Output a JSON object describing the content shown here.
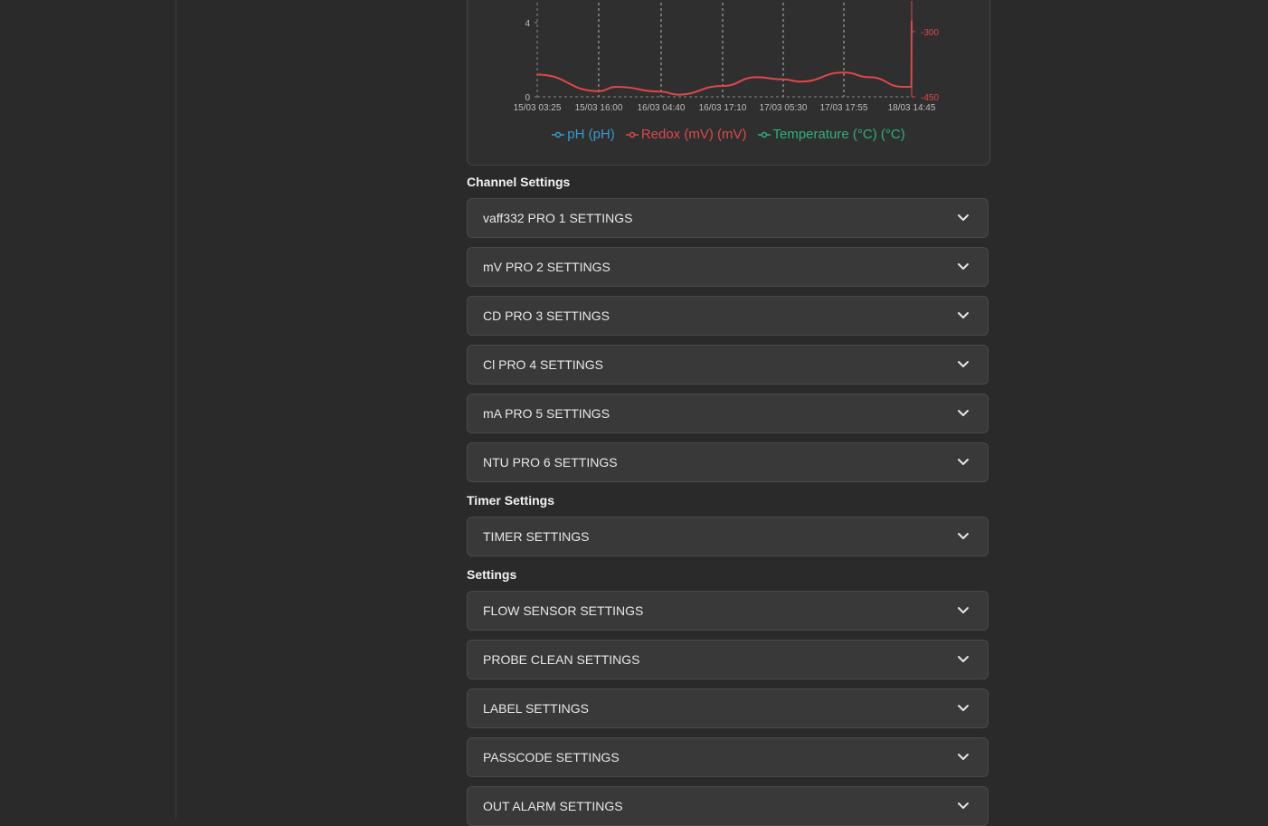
{
  "chart": {
    "legend": [
      {
        "label": "pH (pH)",
        "color": "#3a9ad0"
      },
      {
        "label": "Redox (mV) (mV)",
        "color": "#e0474c"
      },
      {
        "label": "Temperature (°C) (°C)",
        "color": "#2fb07c"
      }
    ]
  },
  "chart_data": {
    "type": "line",
    "x_tick_labels": [
      "15/03 03:25",
      "15/03 16:00",
      "16/03 04:40",
      "16/03 17:10",
      "17/03 05:30",
      "17/03 17:55",
      "18/03 14:45"
    ],
    "y_left_ticks": [
      "0",
      "4"
    ],
    "y_right_ticks": [
      "-300",
      "-450"
    ],
    "grid": true,
    "legend_position": "bottom",
    "series": [
      {
        "name": "Redox (mV) (mV)",
        "axis": "right",
        "color": "#e0474c",
        "points": [
          [
            "15/03 03:25",
            -399
          ],
          [
            "15/03 16:00",
            -437
          ],
          [
            "15/03 19:30",
            -427
          ],
          [
            "16/03 04:40",
            -438
          ],
          [
            "16/03 08:00",
            -445
          ],
          [
            "16/03 17:10",
            -425
          ],
          [
            "17/03 00:00",
            -405
          ],
          [
            "17/03 05:30",
            -410
          ],
          [
            "17/03 09:00",
            -415
          ],
          [
            "17/03 17:55",
            -394
          ],
          [
            "18/03 02:00",
            -405
          ],
          [
            "18/03 12:00",
            -427
          ],
          [
            "18/03 14:40",
            -427
          ],
          [
            "18/03 14:45",
            -275
          ]
        ]
      }
    ]
  },
  "sections": {
    "channel_title": "Channel Settings",
    "timer_title": "Timer Settings",
    "settings_title": "Settings"
  },
  "channel_items": [
    "vaff332 PRO 1 SETTINGS",
    "mV PRO 2 SETTINGS",
    "CD PRO 3 SETTINGS",
    "Cl PRO 4 SETTINGS",
    "mA PRO 5 SETTINGS",
    "NTU PRO 6 SETTINGS"
  ],
  "timer_items": [
    "TIMER SETTINGS"
  ],
  "settings_items": [
    "FLOW SENSOR SETTINGS",
    "PROBE CLEAN SETTINGS",
    "LABEL SETTINGS",
    "PASSCODE SETTINGS",
    "OUT ALARM SETTINGS"
  ],
  "icons": {
    "expand": "chevron-down-icon"
  }
}
